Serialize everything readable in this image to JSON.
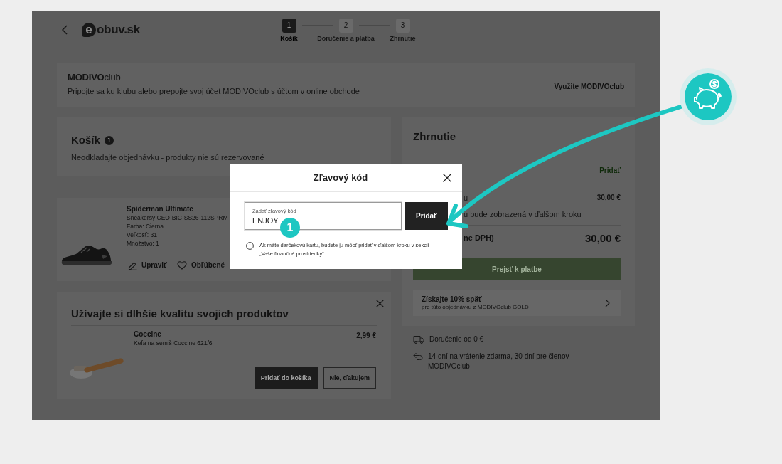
{
  "header": {
    "logo": {
      "mark": "e",
      "text": "obuv.sk"
    },
    "steps": [
      {
        "number": "1",
        "label": "Košík",
        "selected": true
      },
      {
        "number": "2",
        "label": "Doručenie a platba",
        "selected": false
      },
      {
        "number": "3",
        "label": "Zhrnutie",
        "selected": false
      }
    ]
  },
  "club_banner": {
    "brand": "**MODIVO**club",
    "text": "Pripojte sa ku klubu alebo prepojte svoj účet MODIVOclub s účtom v online obchode",
    "link": "Využite MODIVOclub"
  },
  "cart": {
    "title": "Košík",
    "count": "1",
    "note": "Neodkladajte objednávku - produkty nie sú rezervované",
    "items": [
      {
        "name": "Spiderman Ultimate",
        "details": [
          "Sneakersy CEO-BIC-SS26-112SPRM",
          "Farba: Čierna",
          "Veľkosť: 31",
          "Množstvo: 1"
        ],
        "actions": [
          {
            "kind": "edit",
            "label": "Upraviť"
          },
          {
            "kind": "favorite",
            "label": "Obľúbené"
          }
        ]
      }
    ]
  },
  "upsell": {
    "title": "Užívajte si dlhšie kvalitu svojich produktov",
    "product": {
      "name": "Coccine",
      "description": "Kefa na semiš Coccine 621/6",
      "price": "2,99 €"
    },
    "buttons": [
      {
        "kind": "primary",
        "label": "Pridať do košíka"
      },
      {
        "kind": "secondary",
        "label": "Nie, ďakujem"
      }
    ]
  },
  "summary": {
    "title": "Zhrnutie",
    "rows": [
      {
        "kind": "link",
        "value": "Pridať"
      },
      {
        "kind": "amount",
        "label": "u",
        "value": "30,00 €",
        "note": "u bude zobrazená v ďalšom kroku"
      },
      {
        "kind": "total",
        "label": "ne DPH)",
        "value": "30,00 €"
      }
    ],
    "checkout_button": "Prejsť k platbe",
    "cashback": {
      "title": "Získajte 10% späť",
      "text": "pre túto objednávku z MODIVOclub GOLD"
    },
    "benefits": [
      {
        "kind": "delivery",
        "text": "Doručenie od 0 €"
      },
      {
        "kind": "returns",
        "text": "14 dní na vrátenie zdarma, 30 dní pre členov MODIVOclub"
      }
    ]
  },
  "modal": {
    "title": "Zľavový kód",
    "field": {
      "label": "Zadať zľavový kód",
      "value": "ENJOY"
    },
    "button": "Pridať",
    "info": "Ak máte darčekovú kartu, budete ju môcť pridať v ďalšom kroku v sekcii „Vaše finančné prostriedky“."
  },
  "annotation": {
    "step": "1"
  }
}
